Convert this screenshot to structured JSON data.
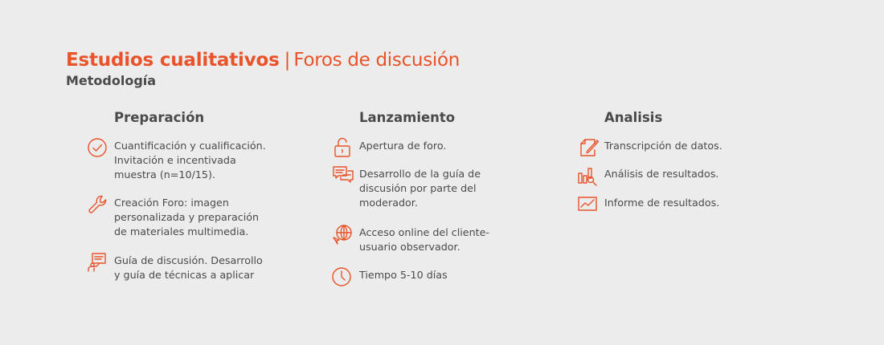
{
  "header": {
    "title_bold": "Estudios cualitativos",
    "separator": "|",
    "title_light": "Foros de discusión",
    "subtitle": "Metodología"
  },
  "columns": [
    {
      "title": "Preparación",
      "items": [
        {
          "icon": "check-circle-icon",
          "lines": [
            "Cuantificación y cualificación.",
            "Invitación e incentivada",
            "muestra (n=10/15)."
          ]
        },
        {
          "icon": "wrench-icon",
          "lines": [
            "Creación Foro: imagen",
            "personalizada y preparación",
            "de materiales multimedia."
          ]
        },
        {
          "icon": "presenter-board-icon",
          "lines": [
            "Guía de discusión. Desarrollo",
            "y guía de técnicas a aplicar"
          ]
        }
      ]
    },
    {
      "title": "Lanzamiento",
      "items": [
        {
          "icon": "unlock-icon",
          "lines": [
            "Apertura de foro."
          ]
        },
        {
          "icon": "chat-bubbles-icon",
          "lines": [
            "Desarrollo de la guía de",
            "discusión por parte del",
            "moderador."
          ]
        },
        {
          "icon": "globe-cursor-icon",
          "lines": [
            "Acceso online del cliente-",
            "usuario observador."
          ]
        },
        {
          "icon": "clock-icon",
          "lines": [
            "Tiempo 5-10 días"
          ]
        }
      ]
    },
    {
      "title": "Analisis",
      "items": [
        {
          "icon": "document-pen-icon",
          "lines": [
            "Transcripción de datos."
          ]
        },
        {
          "icon": "bar-chart-magnifier-icon",
          "lines": [
            "Análisis de resultados."
          ]
        },
        {
          "icon": "line-chart-icon",
          "lines": [
            "Informe de resultados."
          ]
        }
      ]
    }
  ],
  "colors": {
    "accent": "#e8532a",
    "text": "#4a4a4a",
    "background": "#ececec"
  }
}
